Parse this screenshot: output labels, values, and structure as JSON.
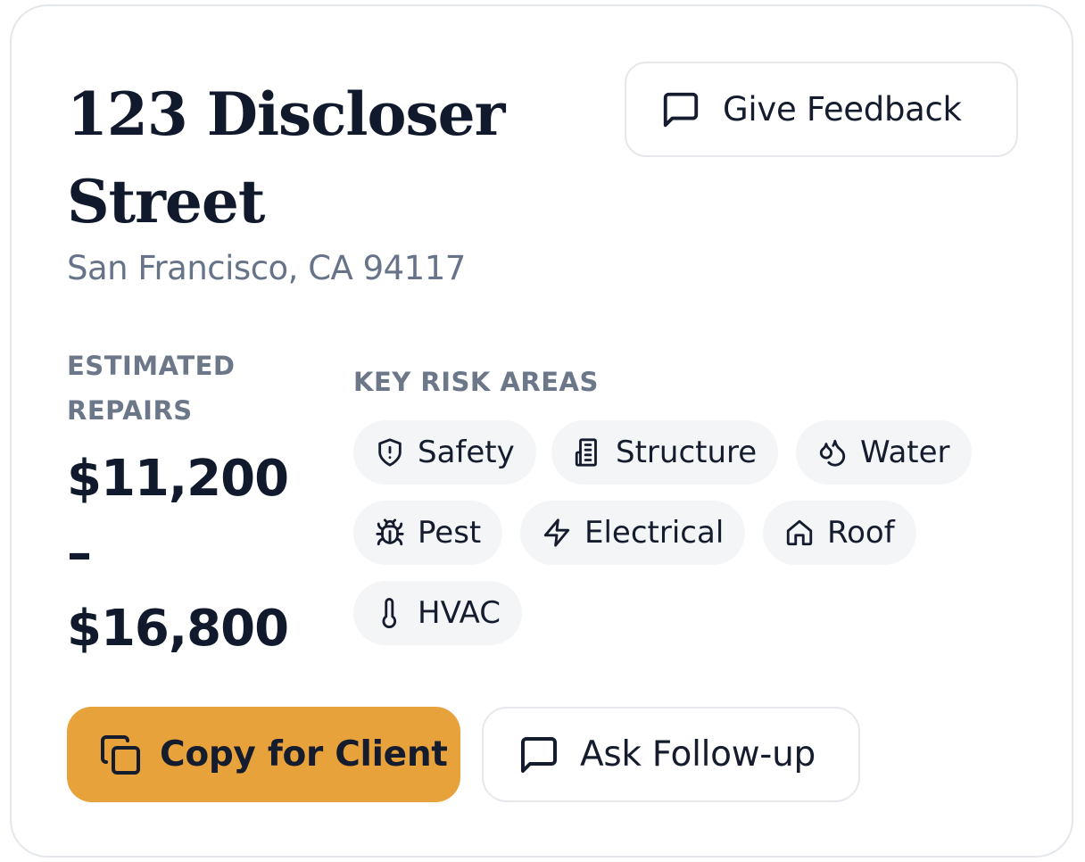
{
  "property": {
    "title": "123 Discloser Street",
    "address": "San Francisco, CA 94117"
  },
  "feedback_button": {
    "label": "Give Feedback",
    "icon": "message-square-icon"
  },
  "estimate": {
    "label": "ESTIMATED REPAIRS",
    "low": "$11,200",
    "separator": "–",
    "high": "$16,800"
  },
  "risks": {
    "label": "KEY RISK AREAS",
    "items": [
      {
        "label": "Safety",
        "icon": "shield-alert-icon"
      },
      {
        "label": "Structure",
        "icon": "building-icon"
      },
      {
        "label": "Water",
        "icon": "droplets-icon"
      },
      {
        "label": "Pest",
        "icon": "bug-icon"
      },
      {
        "label": "Electrical",
        "icon": "zap-icon"
      },
      {
        "label": "Roof",
        "icon": "home-icon"
      },
      {
        "label": "HVAC",
        "icon": "thermometer-icon"
      }
    ]
  },
  "actions": {
    "copy_label": "Copy for Client",
    "ask_label": "Ask Follow-up"
  },
  "colors": {
    "accent": "#e8a23c",
    "text": "#141c2e",
    "muted": "#667389",
    "chip_bg": "#f4f5f7",
    "border": "#e4e7ec"
  }
}
